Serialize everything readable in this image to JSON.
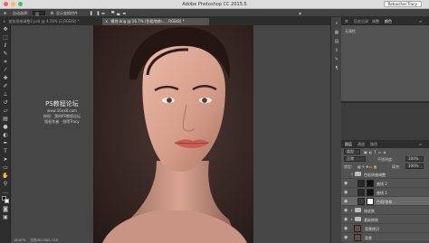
{
  "window": {
    "title": "Adobe Photoshop CC 2015.5",
    "user_button": "Retoucher Tracy"
  },
  "options_bar": {
    "auto_select_label": "自动选择:",
    "auto_select_value": "组",
    "show_transform_label": "显示变换控件"
  },
  "document_tabs": [
    {
      "label": "皮肤质感调整2.psd @ 4.19% (2,RGB/8) *"
    },
    {
      "label": "模特.dng @ 16.7% (色相/饱和... , RGB/8) *"
    }
  ],
  "watermark": {
    "title": "PS教程论坛",
    "line1": "www.16xx8.com",
    "line2": "授权：我的PS教程论坛",
    "line3": "版权作者 · 觉得Tracy"
  },
  "status_bar": {
    "zoom": "16.67%",
    "doc_info": "文档:81.0M/1.71G"
  },
  "right_panels": {
    "tabs": [
      "库",
      "历史记录",
      "调整",
      "颜色"
    ],
    "active_tab": "颜色",
    "history_text": "无属性"
  },
  "layers_panel": {
    "tabs": [
      "图层",
      "通道",
      "路径"
    ],
    "kind_filter": "类型",
    "blend_mode": "正常",
    "opacity_label": "不透明度:",
    "opacity_value": "100%",
    "lock_label": "锁定:",
    "fill_label": "填充:",
    "fill_value": "100%",
    "layers": [
      {
        "name": "色彩质感调整",
        "type": "group"
      },
      {
        "name": "曲线 2",
        "type": "adjustment"
      },
      {
        "name": "曲线 1",
        "type": "adjustment"
      },
      {
        "name": "色相/饱和...",
        "type": "adjustment",
        "selected": true
      },
      {
        "name": "修皮肤",
        "type": "group"
      },
      {
        "name": "基础修饰",
        "type": "group"
      },
      {
        "name": "背景拷贝",
        "type": "image"
      },
      {
        "name": "背景",
        "type": "image"
      }
    ]
  },
  "colors": {
    "close_light": "#fc605c",
    "min_light": "#fdbc40",
    "max_light": "#34c84a",
    "backdrop": "#3a2a27"
  }
}
